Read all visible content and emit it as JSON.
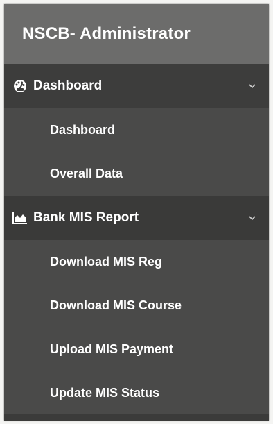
{
  "brand": {
    "title": "NSCB- Administrator"
  },
  "sections": [
    {
      "label": "Dashboard",
      "icon": "dashboard-gauge-icon",
      "expanded": true,
      "items": [
        {
          "label": "Dashboard"
        },
        {
          "label": "Overall Data"
        }
      ]
    },
    {
      "label": "Bank MIS Report",
      "icon": "area-chart-icon",
      "expanded": true,
      "items": [
        {
          "label": "Download MIS Reg"
        },
        {
          "label": "Download MIS Course"
        },
        {
          "label": "Upload MIS Payment"
        },
        {
          "label": "Update MIS Status"
        }
      ]
    }
  ],
  "colors": {
    "brand_bg": "#6c6c6b",
    "sidebar_bg": "#4a4a49",
    "section_bg": "#3d3d3c",
    "text": "#ffffff"
  }
}
